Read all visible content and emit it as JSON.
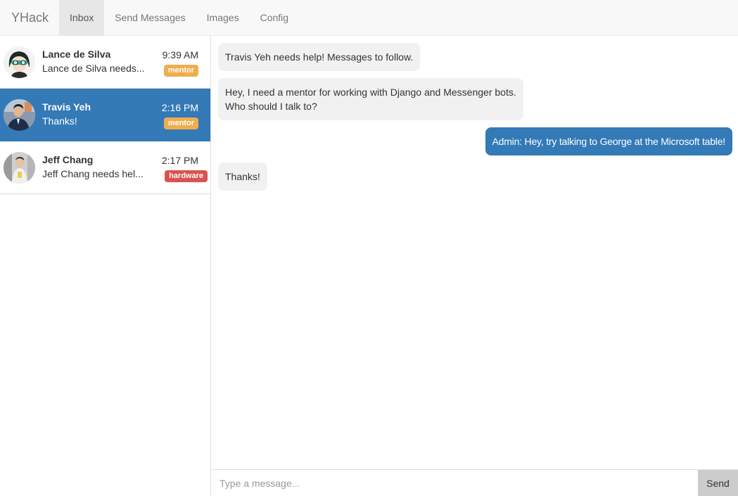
{
  "navbar": {
    "brand": "YHack",
    "items": [
      {
        "label": "Inbox",
        "active": true
      },
      {
        "label": "Send Messages",
        "active": false
      },
      {
        "label": "Images",
        "active": false
      },
      {
        "label": "Config",
        "active": false
      }
    ]
  },
  "conversations": [
    {
      "name": "Lance de Silva",
      "preview": "Lance de Silva needs...",
      "time": "9:39 AM",
      "tag": "mentor",
      "active": false,
      "avatar": "cartoon-avatar"
    },
    {
      "name": "Travis Yeh",
      "preview": "Thanks!",
      "time": "2:16 PM",
      "tag": "mentor",
      "active": true,
      "avatar": "photo-avatar"
    },
    {
      "name": "Jeff Chang",
      "preview": "Jeff Chang needs hel...",
      "time": "2:17 PM",
      "tag": "hardware",
      "active": false,
      "avatar": "photo-avatar"
    }
  ],
  "messages": [
    {
      "direction": "in",
      "lines": [
        "Travis Yeh needs help! Messages to follow."
      ]
    },
    {
      "direction": "in",
      "lines": [
        "Hey, I need a mentor for working with Django and Messenger bots.",
        "Who should I talk to?"
      ]
    },
    {
      "direction": "out",
      "lines": [
        "Admin: Hey, try talking to George at the Microsoft table!"
      ]
    },
    {
      "direction": "in",
      "lines": [
        "Thanks!"
      ]
    }
  ],
  "composer": {
    "placeholder": "Type a message...",
    "send_label": "Send"
  },
  "colors": {
    "primary": "#337ab7",
    "mentor_badge": "#f0ad4e",
    "hardware_badge": "#d9534f",
    "incoming_bubble": "#f1f1f1"
  }
}
